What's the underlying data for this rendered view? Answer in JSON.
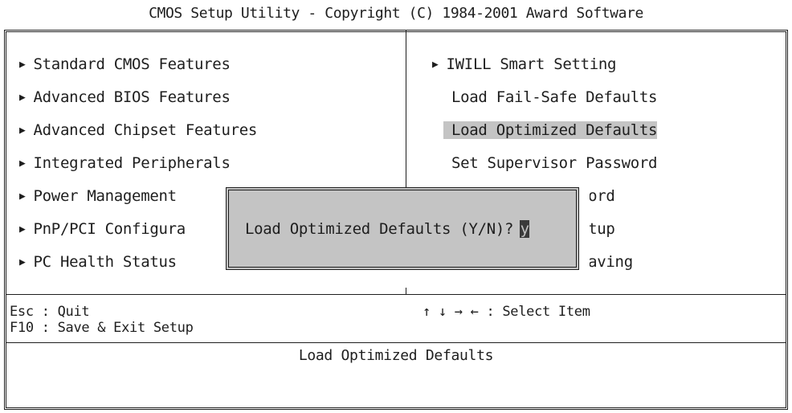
{
  "title": "CMOS Setup Utility - Copyright (C) 1984-2001 Award Software",
  "left_menu": [
    {
      "label": "Standard CMOS Features",
      "submenu": true
    },
    {
      "label": "Advanced BIOS Features",
      "submenu": true
    },
    {
      "label": "Advanced Chipset Features",
      "submenu": true
    },
    {
      "label": "Integrated Peripherals",
      "submenu": true
    },
    {
      "label": "Power Management",
      "submenu": true
    },
    {
      "label": "PnP/PCI Configura",
      "submenu": true
    },
    {
      "label": "PC Health Status",
      "submenu": true
    }
  ],
  "right_menu": [
    {
      "label": "IWILL Smart Setting",
      "submenu": true
    },
    {
      "label": "Load Fail-Safe Defaults",
      "submenu": false
    },
    {
      "label": "Load Optimized Defaults",
      "submenu": false,
      "selected": true
    },
    {
      "label": "Set Supervisor Password",
      "submenu": false
    },
    {
      "label": "word",
      "submenu": false
    },
    {
      "label": "etup",
      "submenu": false
    },
    {
      "label": "Saving",
      "submenu": false
    }
  ],
  "keys": {
    "esc": "Esc : Quit",
    "f10": "F10 : Save & Exit Setup",
    "arrows": "↑ ↓ → ←   : Select Item"
  },
  "help_text": "Load Optimized Defaults",
  "dialog": {
    "prompt": "Load Optimized Defaults (Y/N)?",
    "input_value": "y"
  },
  "icons": {
    "submenu": "submenu-arrow-icon"
  },
  "colors": {
    "text": "#1e1e1e",
    "highlight": "#c4c4c4",
    "background": "#ffffff"
  }
}
